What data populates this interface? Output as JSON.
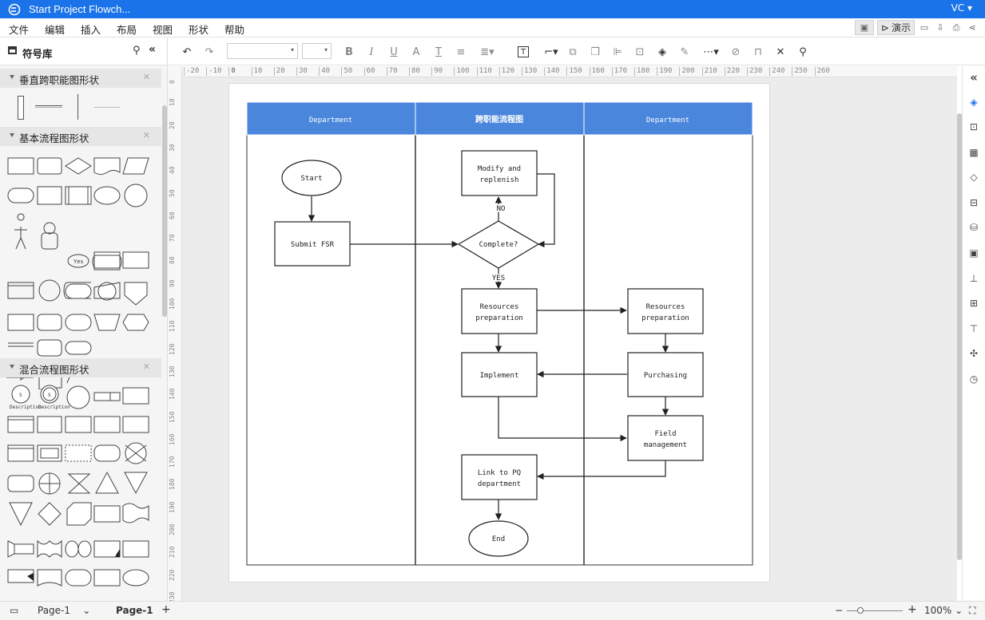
{
  "window": {
    "title": "Start Project Flowch...",
    "user": "VC"
  },
  "menu": [
    "文件",
    "编辑",
    "插入",
    "布局",
    "视图",
    "形状",
    "帮助"
  ],
  "menu_right": {
    "present_label": "演示"
  },
  "sidebar": {
    "title": "符号库",
    "sections": [
      {
        "label": "垂直跨职能图形状"
      },
      {
        "label": "基本流程图形状"
      },
      {
        "label": "混合流程图形状"
      }
    ],
    "shape_labels": {
      "yes": "Yes",
      "description": "Description",
      "s": "S"
    }
  },
  "ruler": {
    "h": [
      "-20",
      "-10",
      "0",
      "10",
      "20",
      "30",
      "40",
      "50",
      "60",
      "70",
      "80",
      "90",
      "100",
      "110",
      "120",
      "130",
      "140",
      "150",
      "160",
      "170",
      "180",
      "190",
      "200",
      "210",
      "220",
      "230",
      "240",
      "250",
      "260"
    ],
    "v": [
      "0",
      "10",
      "20",
      "30",
      "40",
      "50",
      "60",
      "70",
      "80",
      "90",
      "100",
      "110",
      "120",
      "130",
      "140",
      "150",
      "160",
      "170",
      "180",
      "190",
      "200",
      "210",
      "220",
      "230"
    ]
  },
  "diagram": {
    "lanes": [
      {
        "header": "Department"
      },
      {
        "header": "跨职能流程图"
      },
      {
        "header": "Department"
      }
    ],
    "nodes": {
      "start": "Start",
      "submit": "Submit FSR",
      "modify1": "Modify and",
      "modify2": "replenish",
      "complete": "Complete?",
      "res1_a": "Resources",
      "res1_b": "preparation",
      "res2_a": "Resources",
      "res2_b": "preparation",
      "implement": "Implement",
      "purchasing": "Purchasing",
      "field_a": "Field",
      "field_b": "management",
      "link_a": "Link to PQ",
      "link_b": "department",
      "end": "End"
    },
    "edge_labels": {
      "no": "NO",
      "yes": "YES"
    }
  },
  "statusbar": {
    "page_tab": "Page-1",
    "page_active": "Page-1",
    "add": "+",
    "zoom": "100%"
  },
  "colors": {
    "titlebar": "#1a73e8",
    "lane_header": "#4a86dc",
    "accent_icon": "#1a73e8"
  }
}
